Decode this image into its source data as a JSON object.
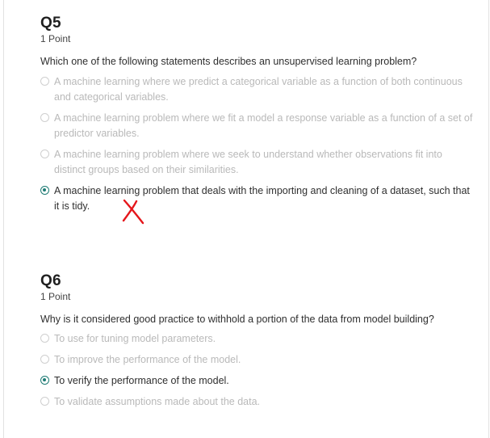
{
  "questions": [
    {
      "title": "Q5",
      "points": "1 Point",
      "prompt": "Which one of the following statements describes an unsupervised learning problem?",
      "options": [
        {
          "label": "A machine learning where we predict a categorical variable as a function of both continuous and categorical variables.",
          "selected": false
        },
        {
          "label": "A machine learning problem where we fit a model a response variable as a function of a set of predictor variables.",
          "selected": false
        },
        {
          "label": "A machine learning problem where we seek to understand whether observations fit into distinct groups based on their similarities.",
          "selected": false
        },
        {
          "label": "A machine learning problem that deals with the importing and cleaning of a dataset, such that it is tidy.",
          "selected": true
        }
      ]
    },
    {
      "title": "Q6",
      "points": "1 Point",
      "prompt": "Why is it considered good practice to withhold a portion of the data from model building?",
      "options": [
        {
          "label": "To use for tuning model parameters.",
          "selected": false
        },
        {
          "label": "To improve the performance of the model.",
          "selected": false
        },
        {
          "label": "To verify the performance of the model.",
          "selected": true
        },
        {
          "label": "To validate assumptions made about the data.",
          "selected": false
        }
      ]
    }
  ],
  "colors": {
    "accent": "#1e7b74",
    "unselected_text": "#b9b9b9",
    "wrong_mark": "#e5161b"
  },
  "annotations": {
    "q5_mark_icon": "handwritten-cross-icon"
  }
}
